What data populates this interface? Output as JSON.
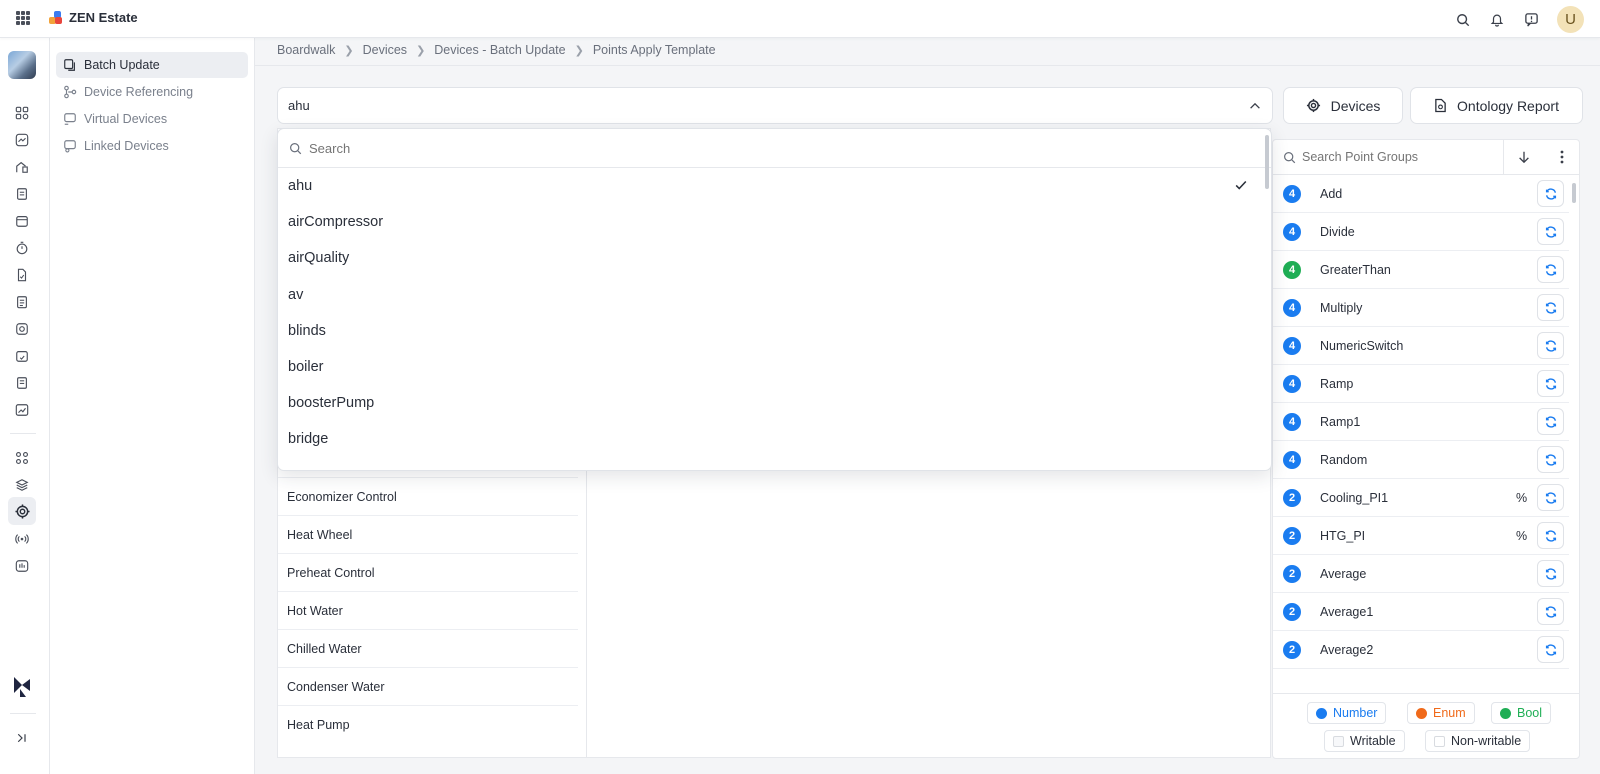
{
  "app": {
    "name": "ZEN Estate",
    "user_initial": "U"
  },
  "subnav": {
    "items": [
      {
        "label": "Batch Update",
        "active": true
      },
      {
        "label": "Device Referencing",
        "active": false
      },
      {
        "label": "Virtual Devices",
        "active": false
      },
      {
        "label": "Linked Devices",
        "active": false
      }
    ]
  },
  "breadcrumb": [
    "Boardwalk",
    "Devices",
    "Devices - Batch Update",
    "Points Apply Template"
  ],
  "template_select": {
    "value": "ahu"
  },
  "buttons": {
    "devices": "Devices",
    "ontology_report": "Ontology Report"
  },
  "dropdown": {
    "search_placeholder": "Search",
    "options": [
      "ahu",
      "airCompressor",
      "airQuality",
      "av",
      "blinds",
      "boiler",
      "boosterPump",
      "bridge"
    ],
    "selected": "ahu"
  },
  "equipment_list": [
    "Economizer Control",
    "Heat Wheel",
    "Preheat Control",
    "Hot Water",
    "Chilled Water",
    "Condenser Water",
    "Heat Pump"
  ],
  "point_groups": {
    "search_placeholder": "Search Point Groups",
    "items": [
      {
        "badge": "4",
        "color": "#1a7cf0",
        "name": "Add",
        "unit": ""
      },
      {
        "badge": "4",
        "color": "#1a7cf0",
        "name": "Divide",
        "unit": ""
      },
      {
        "badge": "4",
        "color": "#1fae55",
        "name": "GreaterThan",
        "unit": ""
      },
      {
        "badge": "4",
        "color": "#1a7cf0",
        "name": "Multiply",
        "unit": ""
      },
      {
        "badge": "4",
        "color": "#1a7cf0",
        "name": "NumericSwitch",
        "unit": ""
      },
      {
        "badge": "4",
        "color": "#1a7cf0",
        "name": "Ramp",
        "unit": ""
      },
      {
        "badge": "4",
        "color": "#1a7cf0",
        "name": "Ramp1",
        "unit": ""
      },
      {
        "badge": "4",
        "color": "#1a7cf0",
        "name": "Random",
        "unit": ""
      },
      {
        "badge": "2",
        "color": "#1a7cf0",
        "name": "Cooling_PI1",
        "unit": "%"
      },
      {
        "badge": "2",
        "color": "#1a7cf0",
        "name": "HTG_PI",
        "unit": "%"
      },
      {
        "badge": "2",
        "color": "#1a7cf0",
        "name": "Average",
        "unit": ""
      },
      {
        "badge": "2",
        "color": "#1a7cf0",
        "name": "Average1",
        "unit": ""
      },
      {
        "badge": "2",
        "color": "#1a7cf0",
        "name": "Average2",
        "unit": ""
      }
    ]
  },
  "legend": {
    "number": {
      "label": "Number",
      "color": "#1a7cf0"
    },
    "enum": {
      "label": "Enum",
      "color": "#f06a1a"
    },
    "bool": {
      "label": "Bool",
      "color": "#1fae55"
    },
    "writable": "Writable",
    "non_writable": "Non-writable"
  }
}
